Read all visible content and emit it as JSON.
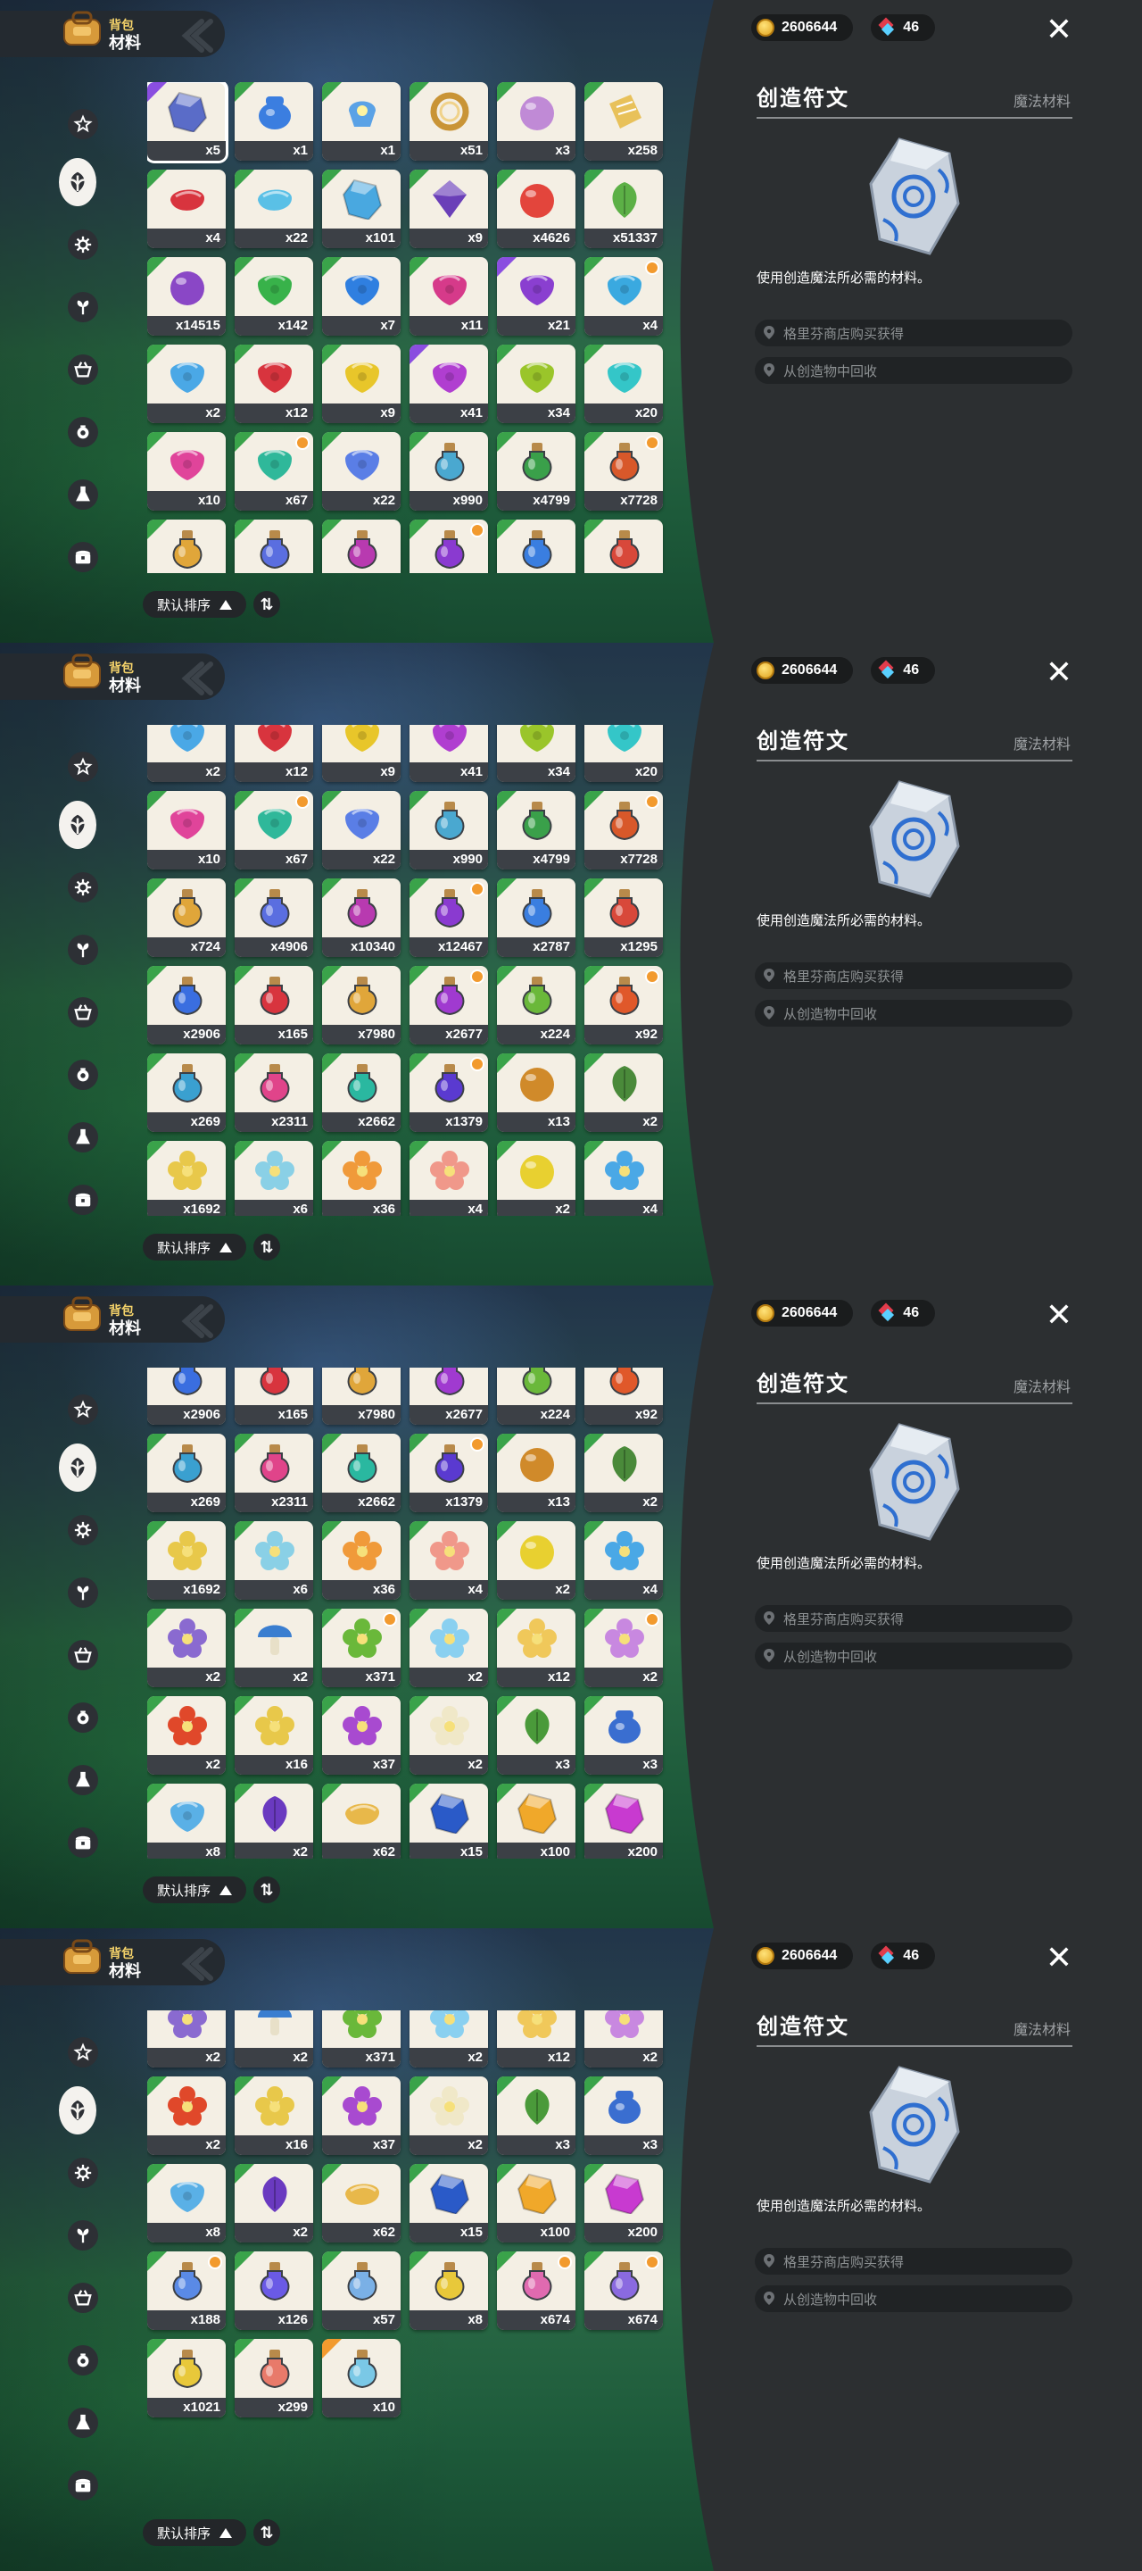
{
  "header": {
    "small": "背包",
    "big": "材料"
  },
  "currency": {
    "coins": "2606644",
    "gems": "46"
  },
  "detail": {
    "title": "创造符文",
    "category": "魔法材料",
    "description": "使用创造魔法所必需的材料。",
    "sources": [
      "格里芬商店购买获得",
      "从创造物中回收"
    ]
  },
  "sort": {
    "label": "默认排序",
    "dir": "⇅"
  },
  "tabs": [
    {
      "name": "tab-misc",
      "icon": "star-icon"
    },
    {
      "name": "tab-materials",
      "icon": "leaf-icon",
      "active": true
    },
    {
      "name": "tab-gear",
      "icon": "gear-icon"
    },
    {
      "name": "tab-plants",
      "icon": "sprout-icon"
    },
    {
      "name": "tab-furniture",
      "icon": "basket-icon"
    },
    {
      "name": "tab-ingredients",
      "icon": "pot-icon"
    },
    {
      "name": "tab-consumables",
      "icon": "flask-icon"
    },
    {
      "name": "tab-treasure",
      "icon": "chest-icon"
    }
  ],
  "colors": {
    "accent_green": "#3aa34a",
    "accent_purple": "#8a4ee0",
    "badge_orange": "#f29a2e",
    "panel": "#2c2f31"
  },
  "items": [
    {
      "c": "x5",
      "col": "#5a6cc8",
      "sel": true,
      "tri": "#8a4ee0",
      "sh": "crystal"
    },
    {
      "c": "x1",
      "col": "#3b7ee0",
      "tri": "#3aa34a",
      "sh": "pot"
    },
    {
      "c": "x1",
      "col": "#5aa2e6",
      "tri": "#3aa34a",
      "sh": "lamp"
    },
    {
      "c": "x51",
      "col": "#c99436",
      "tri": "#3aa34a",
      "sh": "ring"
    },
    {
      "c": "x3",
      "col": "#c08ad6",
      "tri": "#3aa34a",
      "sh": "orb"
    },
    {
      "c": "x258",
      "col": "#e8c15a",
      "tri": "#3aa34a",
      "sh": "paper"
    },
    {
      "c": "x4",
      "col": "#d8343e",
      "tri": "#3aa34a",
      "sh": "cloth"
    },
    {
      "c": "x22",
      "col": "#5ac0e6",
      "tri": "#3aa34a",
      "sh": "cloth"
    },
    {
      "c": "x101",
      "col": "#49a8e0",
      "tri": "#3aa34a",
      "sh": "crystal"
    },
    {
      "c": "x9",
      "col": "#6a3fb8",
      "tri": "#3aa34a",
      "sh": "gem"
    },
    {
      "c": "x4626",
      "col": "#e3453c",
      "tri": "#3aa34a",
      "sh": "orb"
    },
    {
      "c": "x51337",
      "col": "#5cb046",
      "tri": "#3aa34a",
      "sh": "leaf"
    },
    {
      "c": "x14515",
      "col": "#8a47c6",
      "tri": "#3aa34a",
      "sh": "orb"
    },
    {
      "c": "x142",
      "col": "#38b24a",
      "tri": "#3aa34a",
      "sh": "drop"
    },
    {
      "c": "x7",
      "col": "#2f7fe0",
      "tri": "#3aa34a",
      "sh": "drop"
    },
    {
      "c": "x11",
      "col": "#d63a8a",
      "tri": "#3aa34a",
      "sh": "drop"
    },
    {
      "c": "x21",
      "col": "#8a3fd0",
      "tri": "#8a4ee0",
      "sh": "drop"
    },
    {
      "c": "x4",
      "col": "#3aa9e0",
      "tri": "#3aa34a",
      "sh": "drop",
      "badge": true
    },
    {
      "c": "x2",
      "col": "#4aa8e6",
      "tri": "#3aa34a",
      "sh": "drop"
    },
    {
      "c": "x12",
      "col": "#d8343e",
      "tri": "#3aa34a",
      "sh": "drop"
    },
    {
      "c": "x9",
      "col": "#e8c62a",
      "tri": "#3aa34a",
      "sh": "drop"
    },
    {
      "c": "x41",
      "col": "#b03ed0",
      "tri": "#8a4ee0",
      "sh": "drop"
    },
    {
      "c": "x34",
      "col": "#9ac52a",
      "tri": "#3aa34a",
      "sh": "drop"
    },
    {
      "c": "x20",
      "col": "#34c6c8",
      "tri": "#3aa34a",
      "sh": "drop"
    },
    {
      "c": "x10",
      "col": "#e0449a",
      "tri": "#3aa34a",
      "sh": "drop"
    },
    {
      "c": "x67",
      "col": "#2fb89a",
      "tri": "#3aa34a",
      "sh": "drop",
      "badge": true
    },
    {
      "c": "x22",
      "col": "#5a7ee6",
      "tri": "#3aa34a",
      "sh": "drop"
    },
    {
      "c": "x990",
      "col": "#4aa8d0",
      "tri": "#3aa34a",
      "sh": "bottle"
    },
    {
      "c": "x4799",
      "col": "#3aa04a",
      "tri": "#3aa34a",
      "sh": "bottle"
    },
    {
      "c": "x7728",
      "col": "#d8582a",
      "tri": "#3aa34a",
      "sh": "bottle",
      "badge": true
    },
    {
      "c": "x724",
      "col": "#e0a63a",
      "tri": "#3aa34a",
      "sh": "bottle"
    },
    {
      "c": "x4906",
      "col": "#5a6ee0",
      "tri": "#3aa34a",
      "sh": "bottle"
    },
    {
      "c": "x10340",
      "col": "#b83ab0",
      "tri": "#3aa34a",
      "sh": "bottle"
    },
    {
      "c": "x12467",
      "col": "#8a3ad0",
      "tri": "#3aa34a",
      "sh": "bottle",
      "badge": true
    },
    {
      "c": "x2787",
      "col": "#3a7ee0",
      "tri": "#3aa34a",
      "sh": "bottle"
    },
    {
      "c": "x1295",
      "col": "#d8483a",
      "tri": "#3aa34a",
      "sh": "bottle"
    },
    {
      "c": "x2906",
      "col": "#3a6ee0",
      "tri": "#3aa34a",
      "sh": "bottle"
    },
    {
      "c": "x165",
      "col": "#d8343e",
      "tri": "#3aa34a",
      "sh": "bottle"
    },
    {
      "c": "x7980",
      "col": "#e0a63a",
      "tri": "#3aa34a",
      "sh": "bottle"
    },
    {
      "c": "x2677",
      "col": "#a03ad0",
      "tri": "#3aa34a",
      "sh": "bottle",
      "badge": true
    },
    {
      "c": "x224",
      "col": "#6ab83a",
      "tri": "#3aa34a",
      "sh": "bottle"
    },
    {
      "c": "x92",
      "col": "#e0582a",
      "tri": "#3aa34a",
      "sh": "bottle",
      "badge": true
    },
    {
      "c": "x269",
      "col": "#3aa0d0",
      "tri": "#3aa34a",
      "sh": "bottle"
    },
    {
      "c": "x2311",
      "col": "#e0448a",
      "tri": "#3aa34a",
      "sh": "bottle"
    },
    {
      "c": "x2662",
      "col": "#2ab8a0",
      "tri": "#3aa34a",
      "sh": "bottle"
    },
    {
      "c": "x1379",
      "col": "#5a3ad0",
      "tri": "#3aa34a",
      "sh": "bottle",
      "badge": true
    },
    {
      "c": "x13",
      "col": "#d08a2a",
      "tri": "#3aa34a",
      "sh": "orb"
    },
    {
      "c": "x2",
      "col": "#4a8a3a",
      "tri": "#3aa34a",
      "sh": "leaf"
    },
    {
      "c": "x1692",
      "col": "#e8c84a",
      "tri": "#3aa34a",
      "sh": "flower"
    },
    {
      "c": "x6",
      "col": "#8ad0e6",
      "tri": "#3aa34a",
      "sh": "flower"
    },
    {
      "c": "x36",
      "col": "#f09a3a",
      "tri": "#3aa34a",
      "sh": "flower"
    },
    {
      "c": "x4",
      "col": "#f0988a",
      "tri": "#3aa34a",
      "sh": "flower"
    },
    {
      "c": "x2",
      "col": "#e8d030",
      "tri": "#3aa34a",
      "sh": "orb"
    },
    {
      "c": "x4",
      "col": "#4aa8e6",
      "tri": "#3aa34a",
      "sh": "flower"
    },
    {
      "c": "x2",
      "col": "#8a6ad0",
      "tri": "#3aa34a",
      "sh": "flower"
    },
    {
      "c": "x2",
      "col": "#3a7ed0",
      "tri": "#3aa34a",
      "sh": "mushroom"
    },
    {
      "c": "x371",
      "col": "#6ab83a",
      "tri": "#3aa34a",
      "sh": "flower",
      "badge": true
    },
    {
      "c": "x2",
      "col": "#8ad0f0",
      "tri": "#3aa34a",
      "sh": "flower"
    },
    {
      "c": "x12",
      "col": "#f0c85a",
      "tri": "#3aa34a",
      "sh": "flower"
    },
    {
      "c": "x2",
      "col": "#c888e0",
      "tri": "#3aa34a",
      "sh": "flower",
      "badge": true
    },
    {
      "c": "x2",
      "col": "#e0482a",
      "tri": "#3aa34a",
      "sh": "flower"
    },
    {
      "c": "x16",
      "col": "#e8c84a",
      "tri": "#3aa34a",
      "sh": "flower"
    },
    {
      "c": "x37",
      "col": "#a84ad0",
      "tri": "#3aa34a",
      "sh": "flower"
    },
    {
      "c": "x2",
      "col": "#f0e8c8",
      "tri": "#3aa34a",
      "sh": "flower"
    },
    {
      "c": "x3",
      "col": "#4a9a3a",
      "tri": "#3aa34a",
      "sh": "leaf"
    },
    {
      "c": "x3",
      "col": "#3a6ed0",
      "tri": "#3aa34a",
      "sh": "pot"
    },
    {
      "c": "x8",
      "col": "#5ab0e6",
      "tri": "#3aa34a",
      "sh": "drop"
    },
    {
      "c": "x2",
      "col": "#6a3ac0",
      "tri": "#3aa34a",
      "sh": "leaf"
    },
    {
      "c": "x62",
      "col": "#e8b84a",
      "tri": "#3aa34a",
      "sh": "cloth"
    },
    {
      "c": "x15",
      "col": "#2a5ac8",
      "tri": "#3aa34a",
      "sh": "crystal"
    },
    {
      "c": "x100",
      "col": "#f0a82a",
      "tri": "#3aa34a",
      "sh": "crystal"
    },
    {
      "c": "x200",
      "col": "#c83ad0",
      "tri": "#3aa34a",
      "sh": "crystal"
    },
    {
      "c": "x188",
      "col": "#5a8ae6",
      "tri": "#3aa34a",
      "sh": "bottle",
      "badge": true
    },
    {
      "c": "x126",
      "col": "#6a5ae6",
      "tri": "#3aa34a",
      "sh": "bottle"
    },
    {
      "c": "x57",
      "col": "#7ab0e6",
      "tri": "#3aa34a",
      "sh": "bottle"
    },
    {
      "c": "x8",
      "col": "#e8c83a",
      "tri": "#3aa34a",
      "sh": "bottle"
    },
    {
      "c": "x674",
      "col": "#e06ab0",
      "tri": "#3aa34a",
      "sh": "bottle",
      "badge": true
    },
    {
      "c": "x674",
      "col": "#8a6ae0",
      "tri": "#3aa34a",
      "sh": "bottle",
      "badge": true
    },
    {
      "c": "x1021",
      "col": "#e8c83a",
      "tri": "#3aa34a",
      "sh": "bottle"
    },
    {
      "c": "x299",
      "col": "#e87a6a",
      "tri": "#3aa34a",
      "sh": "bottle"
    },
    {
      "c": "x10",
      "col": "#7ac8e6",
      "tri": "#f29a2e",
      "sh": "bottle"
    }
  ],
  "scroll_offsets_rows": [
    0,
    3.25,
    6.25,
    9.25
  ]
}
